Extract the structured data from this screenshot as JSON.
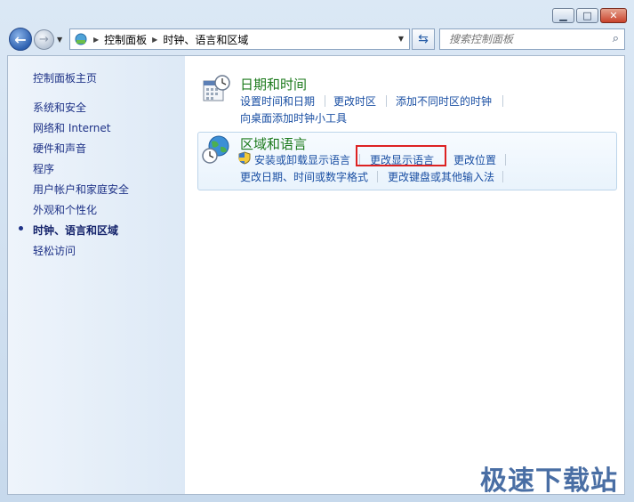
{
  "window": {
    "minimize": "▁",
    "maximize": "□",
    "close": "✕"
  },
  "nav": {
    "back_icon": "arrow-left",
    "forward_icon": "arrow-right"
  },
  "address": {
    "crumbs": [
      "控制面板",
      "时钟、语言和区域"
    ]
  },
  "search": {
    "placeholder": "搜索控制面板"
  },
  "sidebar": {
    "items": [
      {
        "label": "控制面板主页"
      },
      {
        "label": "系统和安全"
      },
      {
        "label": "网络和 Internet"
      },
      {
        "label": "硬件和声音"
      },
      {
        "label": "程序"
      },
      {
        "label": "用户帐户和家庭安全"
      },
      {
        "label": "外观和个性化"
      },
      {
        "label": "时钟、语言和区域",
        "active": true
      },
      {
        "label": "轻松访问"
      }
    ]
  },
  "categories": [
    {
      "title": "日期和时间",
      "icon": "calendar-clock-icon",
      "links_row1": [
        "设置时间和日期",
        "更改时区",
        "添加不同时区的时钟"
      ],
      "links_row2": [
        "向桌面添加时钟小工具"
      ]
    },
    {
      "title": "区域和语言",
      "icon": "globe-clock-icon",
      "links_row1": [
        "安装或卸载显示语言",
        "更改显示语言",
        "更改位置"
      ],
      "links_row2": [
        "更改日期、时间或数字格式",
        "更改键盘或其他输入法"
      ]
    }
  ],
  "watermark": "极速下载站"
}
